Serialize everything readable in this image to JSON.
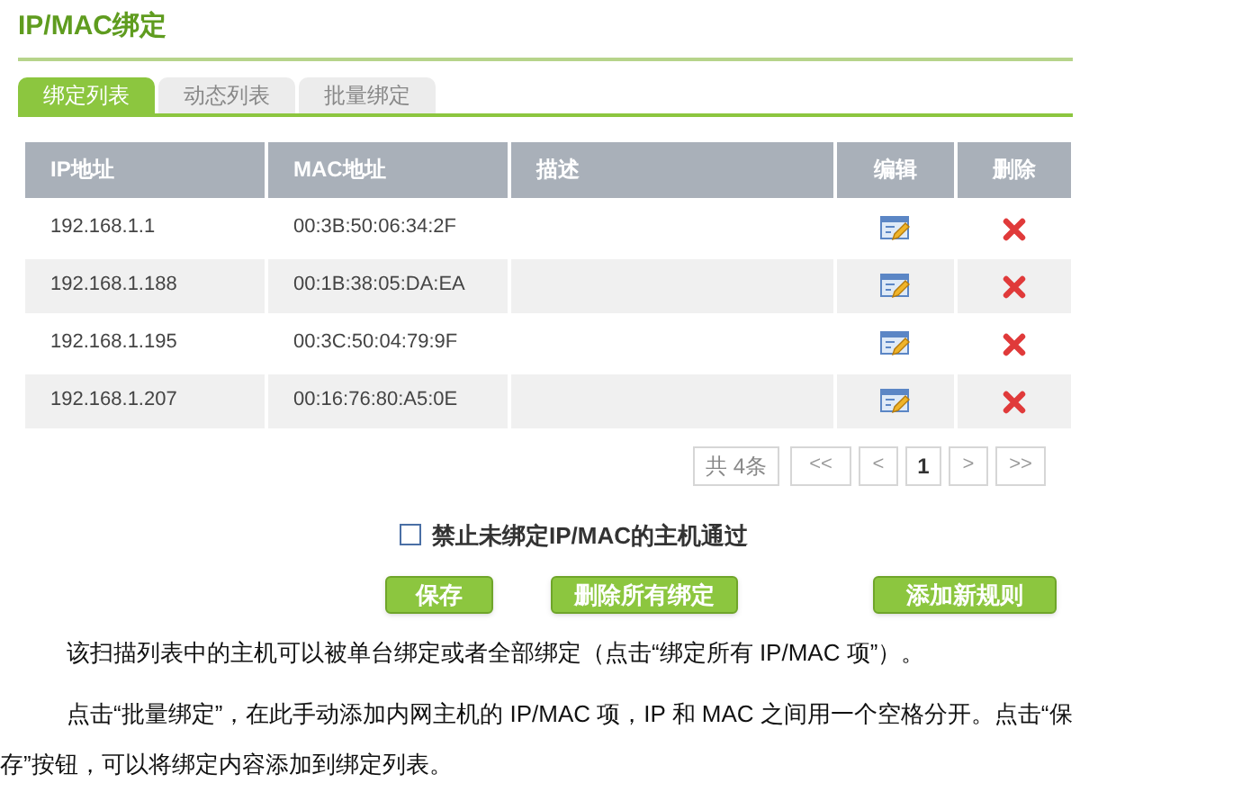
{
  "title": "IP/MAC绑定",
  "tabs": [
    {
      "label": "绑定列表",
      "selected": true
    },
    {
      "label": "动态列表",
      "selected": false
    },
    {
      "label": "批量绑定",
      "selected": false
    }
  ],
  "table": {
    "columns": [
      "IP地址",
      "MAC地址",
      "描述",
      "编辑",
      "删除"
    ],
    "rows": [
      {
        "ip": "192.168.1.1",
        "mac": "00:3B:50:06:34:2F"
      },
      {
        "ip": "192.168.1.188",
        "mac": "00:1B:38:05:DA:EA"
      },
      {
        "ip": "192.168.1.195",
        "mac": "00:3C:50:04:79:9F"
      },
      {
        "ip": "192.168.1.207",
        "mac": "00:16:76:80:A5:0E"
      }
    ]
  },
  "pagination": {
    "total": "共 4条",
    "first": "<<",
    "prev": "<",
    "pages": [
      {
        "label": "1",
        "selected": true
      }
    ],
    "next": ">",
    "last": ">>"
  },
  "block_option": {
    "label": "禁止未绑定IP/MAC的主机通过",
    "checked": false
  },
  "buttons": [
    "保存",
    "删除所有绑定",
    "添加新规则"
  ],
  "notes": [
    "该扫描列表中的主机可以被单台绑定或者全部绑定（点击“绑定所有 IP/MAC 项”）。",
    "点击“批量绑定”，在此手动添加内网主机的 IP/MAC 项，IP 和 MAC 之间用一个空格分开。点击“保存”按钮，可以将绑定内容添加到绑定列表。"
  ]
}
